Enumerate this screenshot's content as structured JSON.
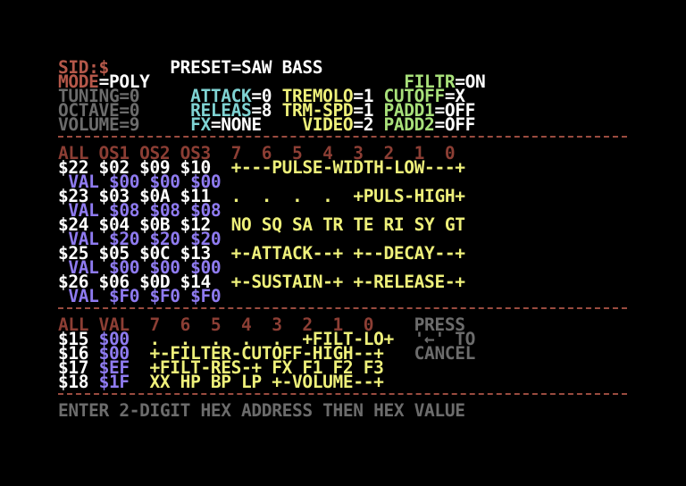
{
  "colors": {
    "white": "#ffffff",
    "red": "#b5584a",
    "dark_red": "#8c3e34",
    "yellow": "#eef07a",
    "green": "#a8e07a",
    "cyan": "#7fd3d3",
    "purple": "#8f7bf0",
    "grey": "#6c6c6c",
    "light_grey": "#bcbcbc"
  },
  "lines": [
    [
      {
        "t": "SID:$",
        "c": "red"
      },
      {
        "t": "      ",
        "c": "white"
      },
      {
        "t": "PRESET=SAW BASS",
        "c": "white"
      }
    ],
    [
      {
        "t": "MODE",
        "c": "red"
      },
      {
        "t": "=POLY",
        "c": "white"
      },
      {
        "t": "                         ",
        "c": "white"
      },
      {
        "t": "FILTR",
        "c": "green"
      },
      {
        "t": "=ON",
        "c": "white"
      }
    ],
    [
      {
        "t": "TUNING=0",
        "c": "grey"
      },
      {
        "t": "     ",
        "c": "white"
      },
      {
        "t": "ATTACK",
        "c": "cyan"
      },
      {
        "t": "=0 ",
        "c": "white"
      },
      {
        "t": "TREMOLO",
        "c": "yellow"
      },
      {
        "t": "=1 ",
        "c": "white"
      },
      {
        "t": "CUTOFF",
        "c": "green"
      },
      {
        "t": "=X",
        "c": "white"
      }
    ],
    [
      {
        "t": "OCTAVE=0",
        "c": "grey"
      },
      {
        "t": "     ",
        "c": "white"
      },
      {
        "t": "RELEAS",
        "c": "cyan"
      },
      {
        "t": "=8 ",
        "c": "white"
      },
      {
        "t": "TRM-SPD",
        "c": "yellow"
      },
      {
        "t": "=1 ",
        "c": "white"
      },
      {
        "t": "PADD1",
        "c": "green"
      },
      {
        "t": "=OFF",
        "c": "white"
      }
    ],
    [
      {
        "t": "VOLUME=9",
        "c": "grey"
      },
      {
        "t": "     ",
        "c": "white"
      },
      {
        "t": "FX",
        "c": "cyan"
      },
      {
        "t": "=NONE",
        "c": "white"
      },
      {
        "t": "    ",
        "c": "white"
      },
      {
        "t": "VIDEO",
        "c": "yellow"
      },
      {
        "t": "=2 ",
        "c": "white"
      },
      {
        "t": "PADD2",
        "c": "green"
      },
      {
        "t": "=OFF",
        "c": "white"
      }
    ],
    [],
    [
      {
        "t": "ALL OS1 OS2 OS3  7  6  5  4  3  2  1  0",
        "c": "dark_red"
      }
    ],
    [
      {
        "t": "$22 $02 $09 $10  ",
        "c": "white"
      },
      {
        "t": "+---PULSE-WIDTH-LOW---+",
        "c": "yellow"
      }
    ],
    [
      {
        "t": " VAL $00 $00 $00",
        "c": "purple"
      }
    ],
    [
      {
        "t": "$23 $03 $0A $11  ",
        "c": "white"
      },
      {
        "t": ".  .  .  .  +PULS-HIGH+",
        "c": "yellow"
      }
    ],
    [
      {
        "t": " VAL $08 $08 $08",
        "c": "purple"
      }
    ],
    [
      {
        "t": "$24 $04 $0B $12  ",
        "c": "white"
      },
      {
        "t": "NO SQ SA TR TE RI SY GT",
        "c": "yellow"
      }
    ],
    [
      {
        "t": " VAL $20 $20 $20",
        "c": "purple"
      }
    ],
    [
      {
        "t": "$25 $05 $0C $13  ",
        "c": "white"
      },
      {
        "t": "+-ATTACK--+ +--DECAY--+",
        "c": "yellow"
      }
    ],
    [
      {
        "t": " VAL $00 $00 $00",
        "c": "purple"
      }
    ],
    [
      {
        "t": "$26 $06 $0D $14  ",
        "c": "white"
      },
      {
        "t": "+-SUSTAIN-+ +-RELEASE-+",
        "c": "yellow"
      }
    ],
    [
      {
        "t": " VAL $F0 $F0 $F0",
        "c": "purple"
      }
    ],
    [],
    [
      {
        "t": "ALL VAL  7  6  5  4  3  2  1  0",
        "c": "dark_red"
      },
      {
        "t": "    ",
        "c": "white"
      },
      {
        "t": "PRESS",
        "c": "grey"
      }
    ],
    [
      {
        "t": "$15 ",
        "c": "white"
      },
      {
        "t": "$00",
        "c": "purple"
      },
      {
        "t": "  ",
        "c": "white"
      },
      {
        "t": ".  .  .  .  .  +FILT-LO+",
        "c": "yellow"
      },
      {
        "t": "  ",
        "c": "white"
      },
      {
        "t": "'←' TO",
        "c": "grey"
      }
    ],
    [
      {
        "t": "$16 ",
        "c": "white"
      },
      {
        "t": "$00",
        "c": "purple"
      },
      {
        "t": "  ",
        "c": "white"
      },
      {
        "t": "+-FILTER-CUTOFF-HIGH--+",
        "c": "yellow"
      },
      {
        "t": "   ",
        "c": "white"
      },
      {
        "t": "CANCEL",
        "c": "grey"
      }
    ],
    [
      {
        "t": "$17 ",
        "c": "white"
      },
      {
        "t": "$EF",
        "c": "purple"
      },
      {
        "t": "  ",
        "c": "white"
      },
      {
        "t": "+FILT-RES-+ FX F1 F2 F3",
        "c": "yellow"
      }
    ],
    [
      {
        "t": "$18 ",
        "c": "white"
      },
      {
        "t": "$1F",
        "c": "purple"
      },
      {
        "t": "  ",
        "c": "white"
      },
      {
        "t": "XX HP BP LP +-VOLUME--+",
        "c": "yellow"
      }
    ],
    [],
    [
      {
        "t": "ENTER 2-DIGIT HEX ADDRESS THEN HEX VALUE",
        "c": "grey"
      }
    ]
  ]
}
